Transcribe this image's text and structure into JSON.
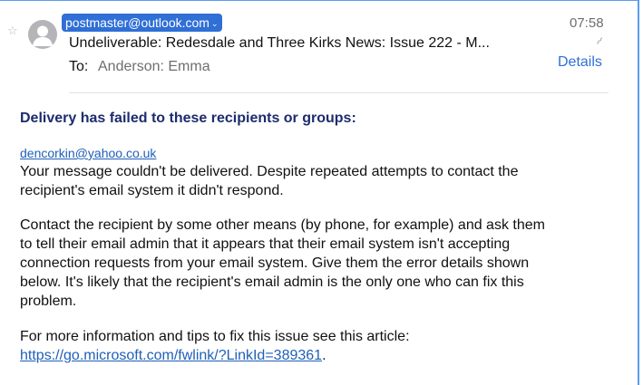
{
  "header": {
    "sender": "postmaster@outlook.com",
    "time": "07:58",
    "subject": "Undeliverable: Redesdale and Three Kirks News: Issue 222 - M...",
    "to_label": "To:",
    "to_value": "Anderson: Emma",
    "details_label": "Details",
    "icons": {
      "star": "star-icon",
      "avatar": "avatar-icon",
      "attachment": "paperclip-icon",
      "dropdown": "chevron-down-icon"
    }
  },
  "body": {
    "heading": "Delivery has failed to these recipients or groups:",
    "recipient_link": "dencorkin@yahoo.co.uk",
    "paragraph1": [
      "Your message couldn't be delivered. Despite repeated attempts to contact the",
      "recipient's email system it didn't respond."
    ],
    "paragraph2": [
      "Contact the recipient by some other means (by phone, for example) and ask them",
      "to tell their email admin that it appears that their email system isn't accepting",
      "connection requests from your email system. Give them the error details shown",
      "below. It's likely that the recipient's email admin is the only one who can fix this",
      "problem."
    ],
    "paragraph3_line1": "For more information and tips to fix this issue see this article:",
    "article_link": "https://go.microsoft.com/fwlink/?LinkId=389361",
    "article_suffix": "."
  },
  "colors": {
    "accent": "#2f6fd6",
    "heading": "#1c2c6e",
    "link": "#1f5fb8",
    "muted": "#6e6e73"
  }
}
